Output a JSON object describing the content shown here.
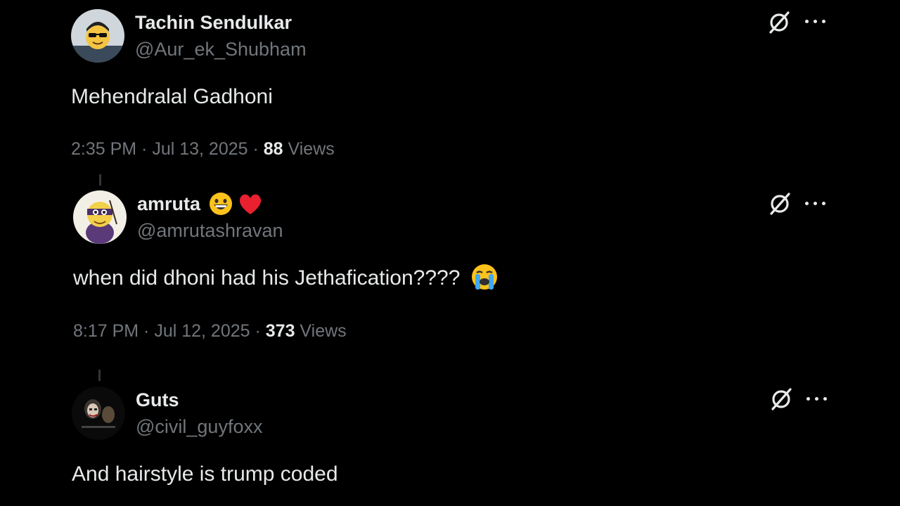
{
  "tweets": [
    {
      "name": "Tachin Sendulkar",
      "handle": "@Aur_ek_Shubham",
      "text": "Mehendralal Gadhoni",
      "time": "2:35 PM · Jul 13, 2025 · ",
      "views_count": "88",
      "views_label": " Views"
    },
    {
      "name": "amruta",
      "name_emojis": [
        "grinning-face",
        "red-heart"
      ],
      "handle": "@amrutashravan",
      "text": "when did dhoni had his Jethafication????",
      "text_emoji": "loudly-crying-face",
      "time": "8:17 PM · Jul 12, 2025 · ",
      "views_count": "373",
      "views_label": " Views"
    },
    {
      "name": "Guts",
      "handle": "@civil_guyfoxx",
      "text": "And hairstyle is trump coded"
    }
  ],
  "icons": {
    "grok": "grok-icon",
    "more": "more-options-icon"
  },
  "colors": {
    "background": "#000000",
    "primary_text": "#e7e9ea",
    "secondary_text": "#71767b"
  }
}
